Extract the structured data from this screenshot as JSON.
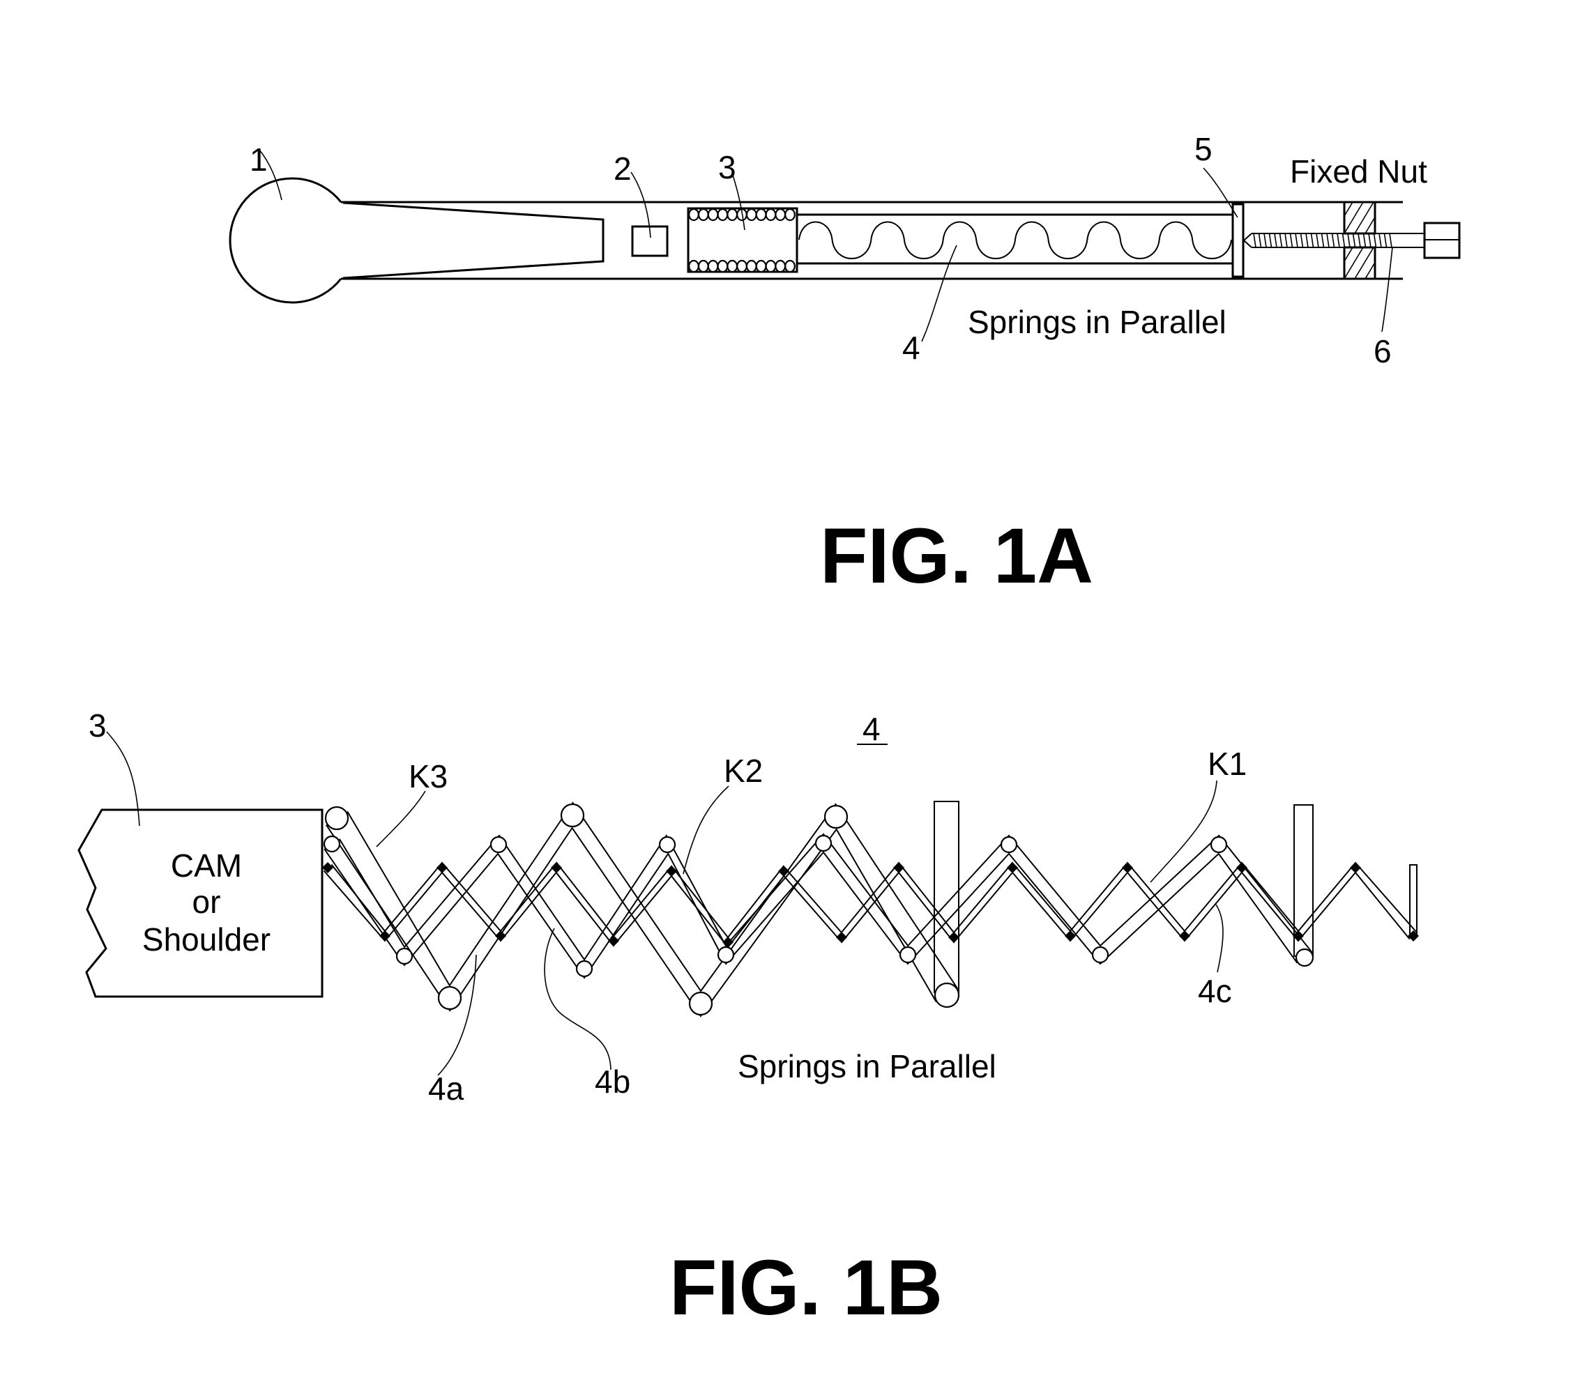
{
  "figure_1a": {
    "title": "FIG. 1A",
    "caption": "Springs in Parallel",
    "fixed_nut_label": "Fixed Nut",
    "reference_numerals": {
      "ball": "1",
      "block": "2",
      "cam": "3",
      "springs": "4",
      "plate": "5",
      "screw": "6"
    }
  },
  "figure_1b": {
    "title": "FIG. 1B",
    "caption": "Springs in Parallel",
    "cam_box_lines": [
      "CAM",
      "or",
      "Shoulder"
    ],
    "reference_numerals": {
      "cam": "3",
      "spring_assembly": "4",
      "spring_a": "4a",
      "spring_b": "4b",
      "spring_c": "4c"
    },
    "stiffness_labels": {
      "k1": "K1",
      "k2": "K2",
      "k3": "K3"
    }
  }
}
